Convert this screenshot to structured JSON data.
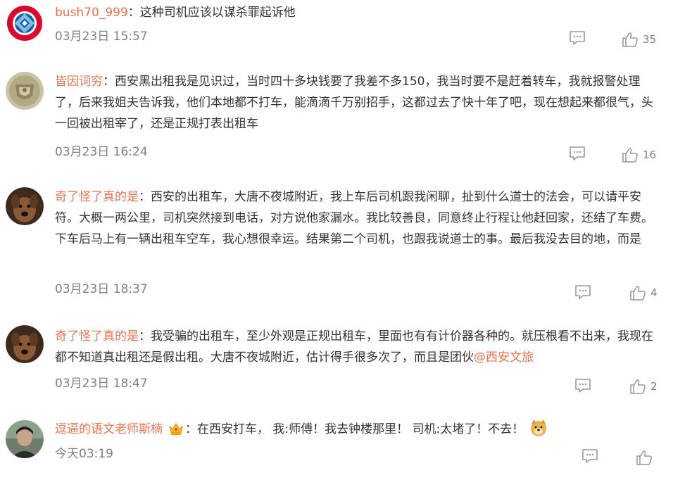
{
  "comments": [
    {
      "username": "bush70_999",
      "separator": "：",
      "text": "这种司机应该以谋杀罪起诉他",
      "time": "03月23日 15:57",
      "likes": "35",
      "avatar_icon": "fc-bayern-logo"
    },
    {
      "username": "皆因词穷",
      "separator": "：",
      "text": "西安黑出租我是见识过，当时四十多块钱要了我差不多150，我当时要不是赶着转车，我就报警处理了，后来我姐夫告诉我，他们本地都不打车，能滴滴千万别招手，这都过去了快十年了吧，现在想起来都很气，头一回被出租宰了，还是正规打表出租车",
      "time": "03月23日 16:24",
      "likes": "16",
      "avatar_icon": "manchester-united-crest"
    },
    {
      "username": "奇了怪了真的是",
      "separator": "：",
      "text": "西安的出租车，大唐不夜城附近，我上车后司机跟我闲聊，扯到什么道士的法会，可以请平安符。大概一两公里，司机突然接到电话，对方说他家漏水。我比较善良，同意终止行程让他赶回家，还结了车费。下车后马上有一辆出租车空车，我心想很幸运。结果第二个司机，也跟我说道士的事。最后我没去目的地，而是",
      "time": "03月23日 18:37",
      "likes": "4",
      "avatar_icon": "dog-photo"
    },
    {
      "username": "奇了怪了真的是",
      "separator": "：",
      "text": "我受骗的出租车，至少外观是正规出租车，里面也有有计价器各种的。就压根看不出来，我现在都不知道真出租还是假出租。大唐不夜城附近，估计得手很多次了，而且是团伙",
      "mention": "@西安文旅",
      "time": "03月23日 18:47",
      "likes": "2",
      "avatar_icon": "dog-photo"
    },
    {
      "username": "逗逼的语文老师斯楠",
      "separator": "：",
      "text": "在西安打车， 我:师傅！我去钟楼那里！ 司机:太堵了！不去！",
      "time": "今天03:19",
      "likes": "",
      "avatar_icon": "man-photo",
      "badge_icon": "vip-crown-icon",
      "emoji_icon": "doge-emoji-icon"
    }
  ],
  "colors": {
    "username": "#eb7350",
    "text": "#333333",
    "meta": "#808080",
    "icon": "#999999"
  }
}
